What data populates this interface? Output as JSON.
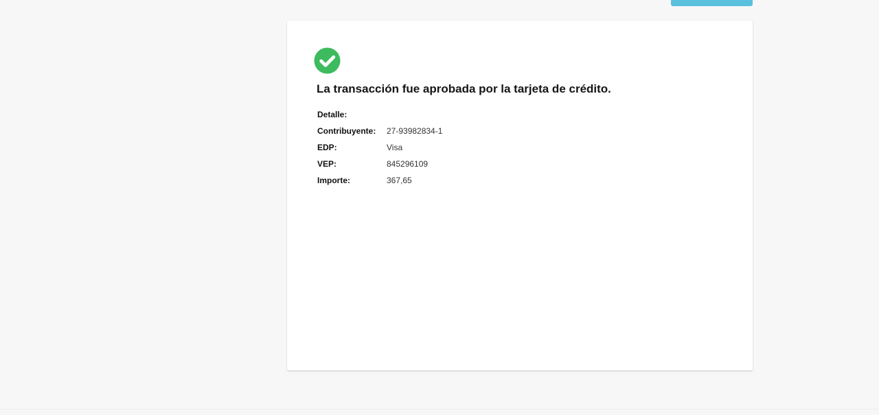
{
  "theme": {
    "background": "#f7f7f7",
    "card_background": "#ffffff",
    "success_color": "#3dbb5e",
    "top_button_color": "#5bc0de"
  },
  "result": {
    "icon": "check-circle-icon",
    "message": "La transacción fue aprobada por la tarjeta de crédito."
  },
  "details": {
    "heading": "Detalle:",
    "rows": [
      {
        "label": "Contribuyente:",
        "value": "27-93982834-1"
      },
      {
        "label": "EDP:",
        "value": "Visa"
      },
      {
        "label": "VEP:",
        "value": "845296109"
      },
      {
        "label": "Importe:",
        "value": "367,65"
      }
    ]
  }
}
